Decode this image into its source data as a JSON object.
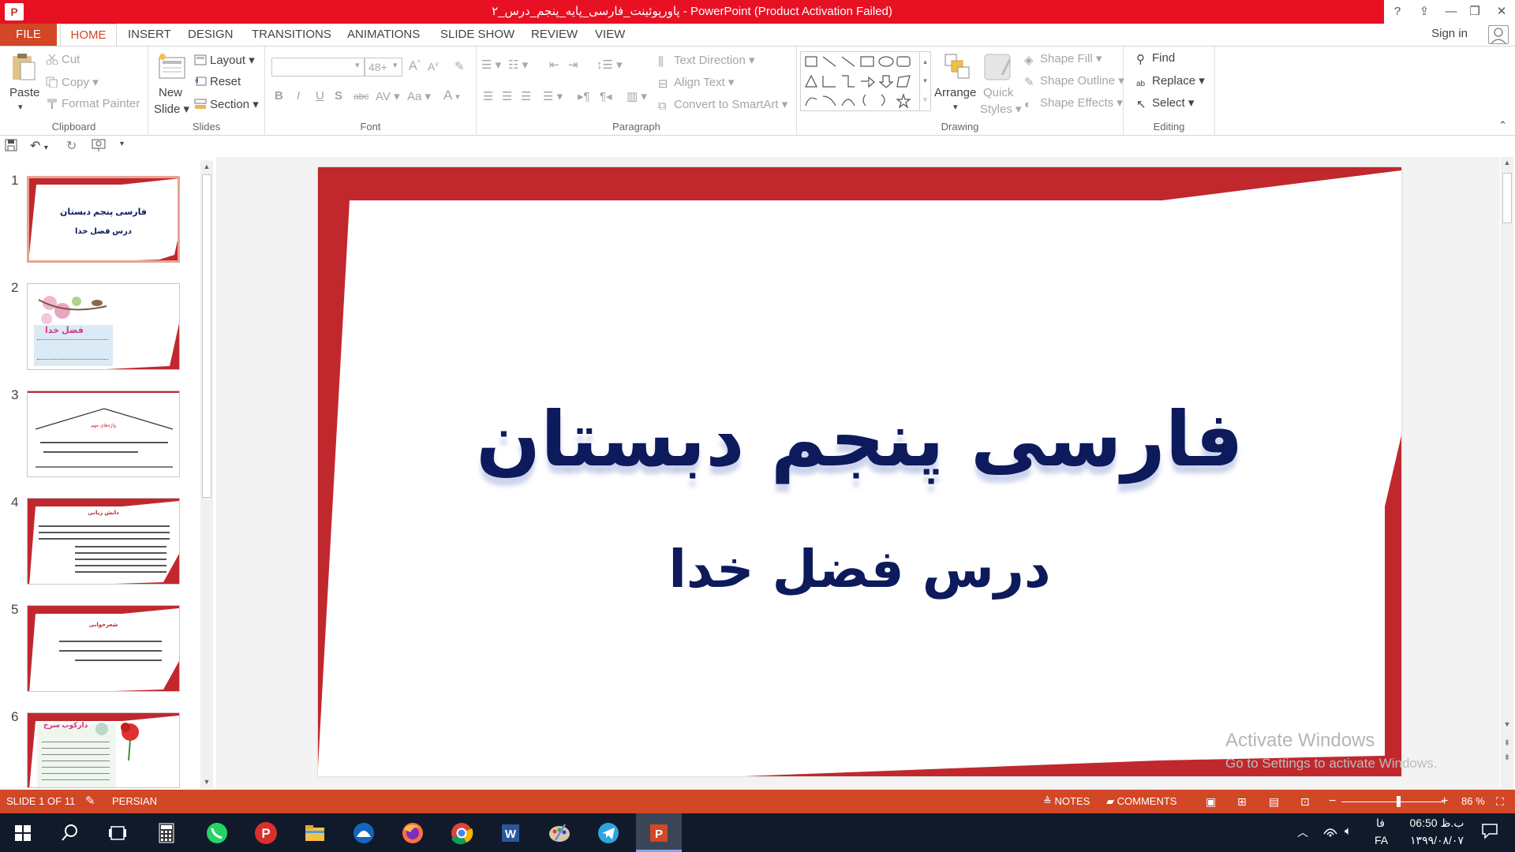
{
  "window": {
    "title": "پاورپوئینت_فارسی_پایه_پنجم_درس_۲ - PowerPoint (Product Activation Failed)",
    "app_icon_letter": "P",
    "help": "?",
    "controls": [
      "⇪",
      "—",
      "❐",
      "✕"
    ]
  },
  "tabs": [
    "FILE",
    "HOME",
    "INSERT",
    "DESIGN",
    "TRANSITIONS",
    "ANIMATIONS",
    "SLIDE SHOW",
    "REVIEW",
    "VIEW"
  ],
  "account": {
    "sign_in": "Sign in"
  },
  "ribbon": {
    "clipboard": {
      "label": "Clipboard",
      "paste": "Paste",
      "cut": "Cut",
      "copy": "Copy",
      "format_painter": "Format Painter"
    },
    "slides": {
      "label": "Slides",
      "new_slide_1": "New",
      "new_slide_2": "Slide",
      "layout": "Layout",
      "reset": "Reset",
      "section": "Section"
    },
    "font": {
      "label": "Font",
      "font_name": "",
      "font_size": "48+",
      "grow": "A",
      "shrink": "A",
      "bold": "B",
      "italic": "I",
      "underline": "U",
      "shadow": "S",
      "strike": "abc",
      "spacing": "AV",
      "case": "Aa",
      "color": "A"
    },
    "paragraph": {
      "label": "Paragraph",
      "text_direction": "Text Direction",
      "align_text": "Align Text",
      "convert_smartart": "Convert to SmartArt"
    },
    "drawing": {
      "label": "Drawing",
      "arrange": "Arrange",
      "quick_styles_1": "Quick",
      "quick_styles_2": "Styles",
      "shape_fill": "Shape Fill",
      "shape_outline": "Shape Outline",
      "shape_effects": "Shape Effects"
    },
    "editing": {
      "label": "Editing",
      "find": "Find",
      "replace": "Replace",
      "select": "Select"
    }
  },
  "thumbnails": [
    {
      "num": "1",
      "title": "فارسی پنجم دبستان",
      "subtitle": "درس فضل خدا"
    },
    {
      "num": "2",
      "title": "فضل خدا"
    },
    {
      "num": "3",
      "title": "واژه‌های مهم"
    },
    {
      "num": "4",
      "title": "دانش زبانی"
    },
    {
      "num": "5",
      "title": "شعرخوانی"
    },
    {
      "num": "6",
      "title": "دارکوب سرخ"
    }
  ],
  "slide": {
    "title": "فارسی پنجم دبستان",
    "subtitle": "درس فضل خدا"
  },
  "watermark": {
    "line1": "Activate Windows",
    "line2": "Go to Settings to activate Windows."
  },
  "status": {
    "slide_of": "SLIDE 1 OF 11",
    "language": "PERSIAN",
    "notes": "NOTES",
    "comments": "COMMENTS",
    "zoom_percent": "86 %",
    "zoom_level": 0.55
  },
  "taskbar": {
    "time": "06:50 ب.ظ",
    "date": "۱۳۹۹/۰۸/۰۷",
    "lang_1": "فا",
    "lang_2": "FA"
  },
  "colors": {
    "accent": "#d24726",
    "slide_red": "#c0282e",
    "title_navy": "#0d1a5c",
    "titlebar_red": "#e81123"
  }
}
